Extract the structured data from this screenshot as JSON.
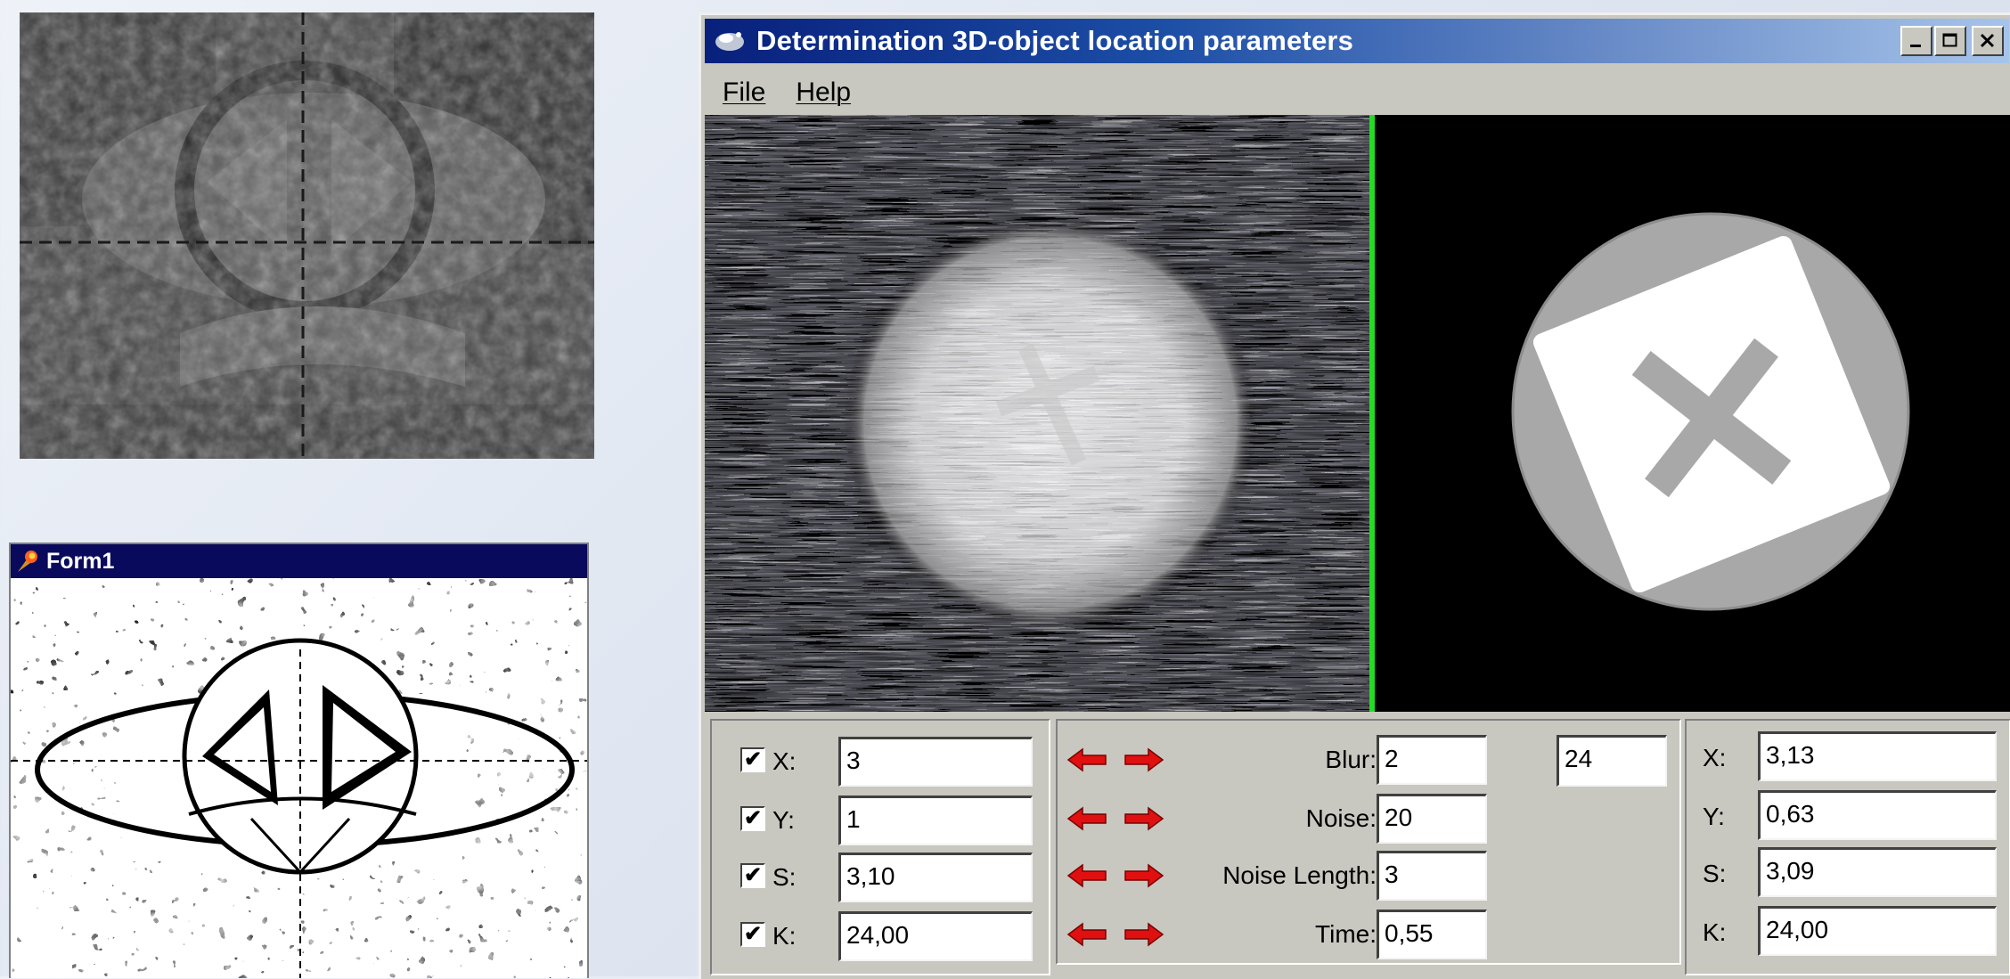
{
  "form1": {
    "title": "Form1"
  },
  "window": {
    "title": "Determination 3D-object location parameters",
    "menu": [
      "File",
      "Help"
    ]
  },
  "left_params": [
    {
      "label": "X:",
      "value": "3",
      "checked": true
    },
    {
      "label": "Y:",
      "value": "1",
      "checked": true
    },
    {
      "label": "S:",
      "value": "3,10",
      "checked": true
    },
    {
      "label": "K:",
      "value": "24,00",
      "checked": true
    }
  ],
  "mid_params": [
    {
      "label": "Blur:",
      "value": "2"
    },
    {
      "label": "Noise:",
      "value": "20"
    },
    {
      "label": "Noise Length:",
      "value": "3"
    },
    {
      "label": "Time:",
      "value": "0,55"
    }
  ],
  "extra_value": "24",
  "right_params": [
    {
      "label": "X:",
      "value": "3,13"
    },
    {
      "label": "Y:",
      "value": "0,63"
    },
    {
      "label": "S:",
      "value": "3,09"
    },
    {
      "label": "K:",
      "value": "24,00"
    }
  ],
  "checkbox_glyph": "✔",
  "icons": {
    "arrow_left": "red-left-arrow",
    "arrow_right": "red-right-arrow",
    "app": "satellite-icon",
    "form": "delphi-torch-icon"
  },
  "colors": {
    "title_active": "#08207c",
    "divider": "#22dd22",
    "arrow": "#e01010"
  }
}
